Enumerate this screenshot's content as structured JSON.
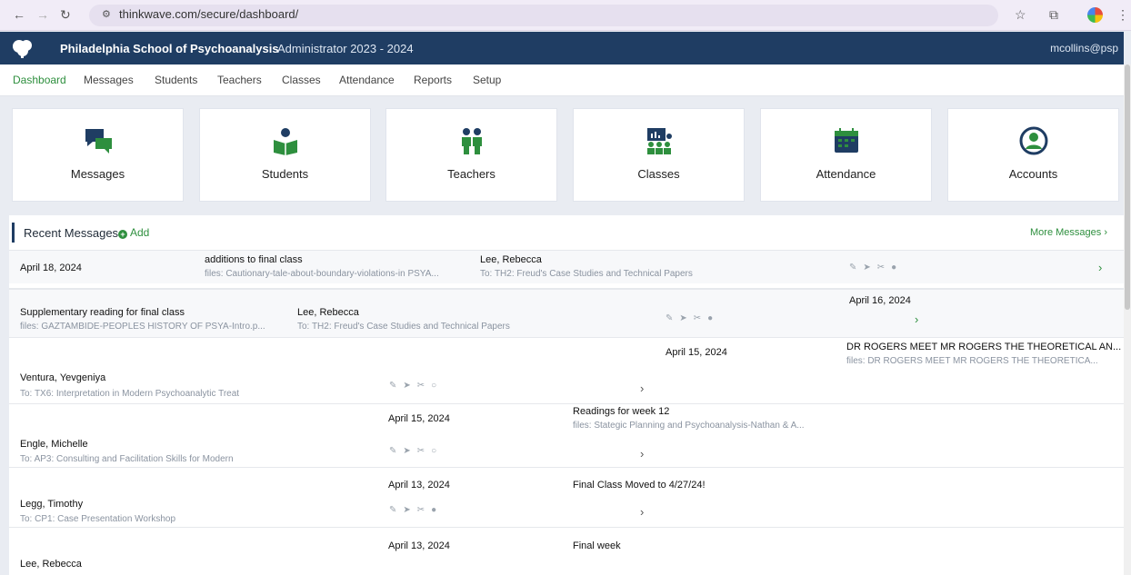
{
  "browser": {
    "url": "thinkwave.com/secure/dashboard/"
  },
  "header": {
    "school": "Philadelphia School of Psychoanalysis",
    "term": "Administrator 2023 - 2024",
    "user": "mcollins@psp"
  },
  "nav": [
    "Dashboard",
    "Messages",
    "Students",
    "Teachers",
    "Classes",
    "Attendance",
    "Reports",
    "Setup"
  ],
  "nav_active": "Dashboard",
  "cards": [
    {
      "label": "Messages",
      "icon": "messages-icon"
    },
    {
      "label": "Students",
      "icon": "students-icon"
    },
    {
      "label": "Teachers",
      "icon": "teachers-icon"
    },
    {
      "label": "Classes",
      "icon": "classes-icon"
    },
    {
      "label": "Attendance",
      "icon": "attendance-icon"
    },
    {
      "label": "Accounts",
      "icon": "accounts-icon"
    }
  ],
  "messages_panel": {
    "title": "Recent Messages",
    "add": "Add",
    "more": "More Messages",
    "rows": [
      {
        "date": "April 18, 2024",
        "subject": "additions to final class",
        "files": "files: Cautionary-tale-about-boundary-violations-in PSYA...",
        "sender": "Lee, Rebecca",
        "to": "To: TH2: Freud's Case Studies and Technical Papers"
      },
      {
        "date": "April 16, 2024",
        "subject": "Supplementary reading for final class",
        "files": "files: GAZTAMBIDE-PEOPLES HISTORY OF PSYA-Intro.p...",
        "sender": "Lee, Rebecca",
        "to": "To: TH2: Freud's Case Studies and Technical Papers"
      },
      {
        "date": "April 15, 2024",
        "subject": "DR ROGERS MEET MR ROGERS THE THEORETICAL AN...",
        "files": "files: DR ROGERS MEET MR ROGERS THE THEORETICA...",
        "sender": "Ventura, Yevgeniya",
        "to": "To: TX6: Interpretation in Modern Psychoanalytic Treat"
      },
      {
        "date": "April 15, 2024",
        "subject": "Readings for week 12",
        "files": "files: Stategic Planning and Psychoanalysis-Nathan & A...",
        "sender": "Engle, Michelle",
        "to": "To: AP3: Consulting and Facilitation Skills for Modern"
      },
      {
        "date": "April 13, 2024",
        "subject": "Final Class Moved to 4/27/24!",
        "files": "",
        "sender": "Legg, Timothy",
        "to": "To: CP1: Case Presentation Workshop"
      },
      {
        "date": "April 13, 2024",
        "subject": "Final week",
        "files": "",
        "sender": "Lee, Rebecca",
        "to": ""
      }
    ]
  },
  "colors": {
    "brand": "#1f3d63",
    "accent": "#2e8f3e"
  }
}
